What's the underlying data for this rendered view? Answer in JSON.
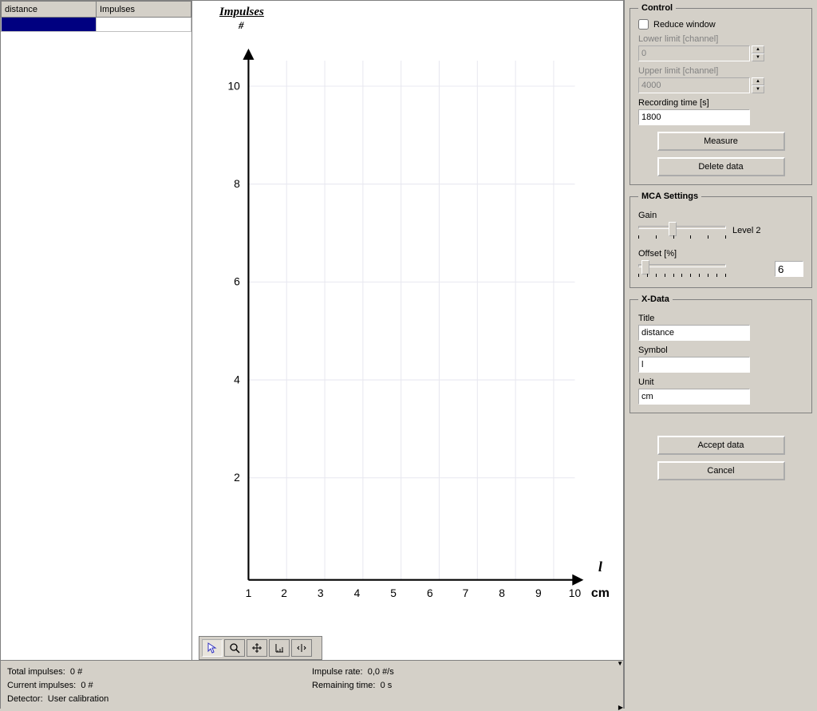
{
  "table": {
    "headers": [
      "distance",
      "Impulses"
    ]
  },
  "chart": {
    "y_title": "Impulses",
    "y_unit": "#",
    "x_title": "l",
    "x_unit": "cm"
  },
  "chart_data": {
    "type": "scatter",
    "title": "Impulses",
    "xlabel": "l",
    "ylabel": "#",
    "x_unit": "cm",
    "x_ticks": [
      1,
      2,
      3,
      4,
      5,
      6,
      7,
      8,
      9,
      10
    ],
    "y_ticks": [
      2,
      4,
      6,
      8,
      10
    ],
    "xlim": [
      1,
      10
    ],
    "ylim": [
      0,
      11
    ],
    "series": []
  },
  "status": {
    "total_label": "Total impulses:",
    "total_val": "0 #",
    "current_label": "Current impulses:",
    "current_val": "0 #",
    "detector_label": "Detector:",
    "detector_val": "User calibration",
    "rate_label": "Impulse rate:",
    "rate_val": "0,0 #/s",
    "remaining_label": "Remaining time:",
    "remaining_val": "0 s"
  },
  "control": {
    "legend": "Control",
    "reduce_window": "Reduce window",
    "lower_limit_label": "Lower limit [channel]",
    "lower_limit_val": "0",
    "upper_limit_label": "Upper limit [channel]",
    "upper_limit_val": "4000",
    "recording_time_label": "Recording time [s]",
    "recording_time_val": "1800",
    "measure_btn": "Measure",
    "delete_btn": "Delete data"
  },
  "mca": {
    "legend": "MCA Settings",
    "gain_label": "Gain",
    "gain_level": "Level 2",
    "offset_label": "Offset [%]",
    "offset_val": "6"
  },
  "xdata": {
    "legend": "X-Data",
    "title_label": "Title",
    "title_val": "distance",
    "symbol_label": "Symbol",
    "symbol_val": "l",
    "unit_label": "Unit",
    "unit_val": "cm"
  },
  "buttons": {
    "accept": "Accept data",
    "cancel": "Cancel"
  }
}
